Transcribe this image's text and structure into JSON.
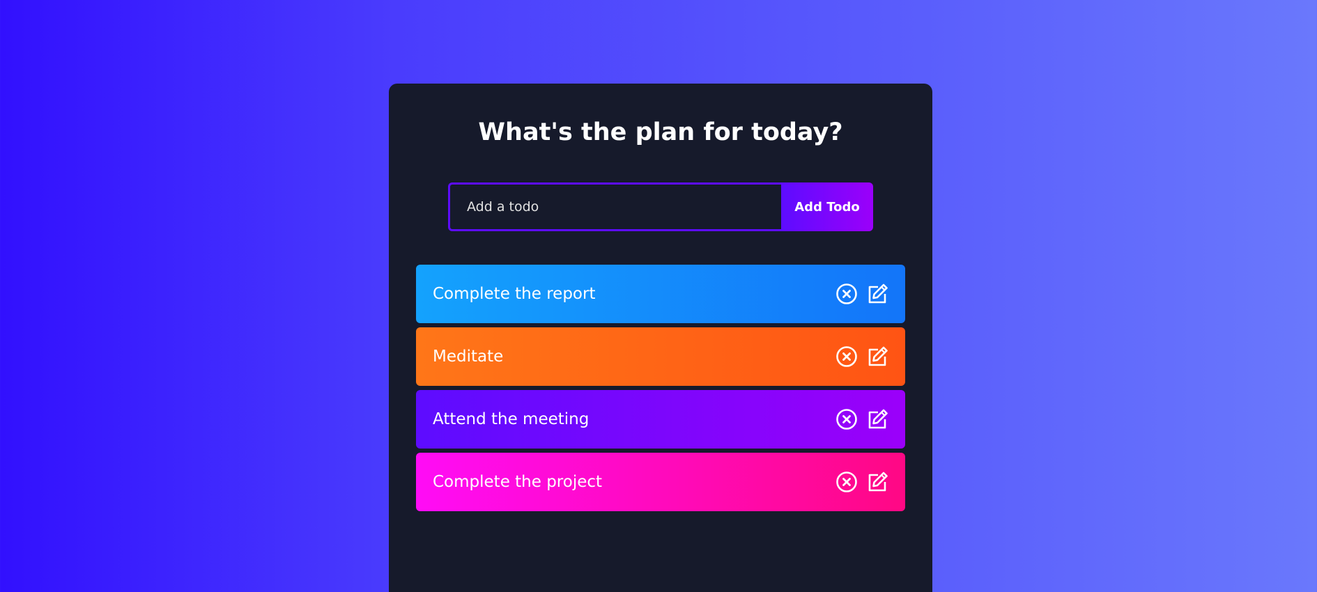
{
  "header": {
    "title": "What's the plan for today?"
  },
  "form": {
    "placeholder": "Add a todo",
    "value": "",
    "button_label": "Add Todo"
  },
  "todos": [
    {
      "text": "Complete the report",
      "delete_icon": "close-circle-icon",
      "edit_icon": "edit-icon",
      "color_from": "#14a2fd",
      "color_to": "#1375f9"
    },
    {
      "text": "Meditate",
      "delete_icon": "close-circle-icon",
      "edit_icon": "edit-icon",
      "color_from": "#ff7618",
      "color_to": "#ff5414"
    },
    {
      "text": "Attend the meeting",
      "delete_icon": "close-circle-icon",
      "edit_icon": "edit-icon",
      "color_from": "#5d0cff",
      "color_to": "#9b00fa"
    },
    {
      "text": "Complete the project",
      "delete_icon": "close-circle-icon",
      "edit_icon": "edit-icon",
      "color_from": "#ff0cf6",
      "color_to": "#ff0884"
    }
  ],
  "colors": {
    "background_from": "#3210fe",
    "background_to": "#6a78fc",
    "panel": "#161a2b",
    "accent": "#5d0cff"
  }
}
